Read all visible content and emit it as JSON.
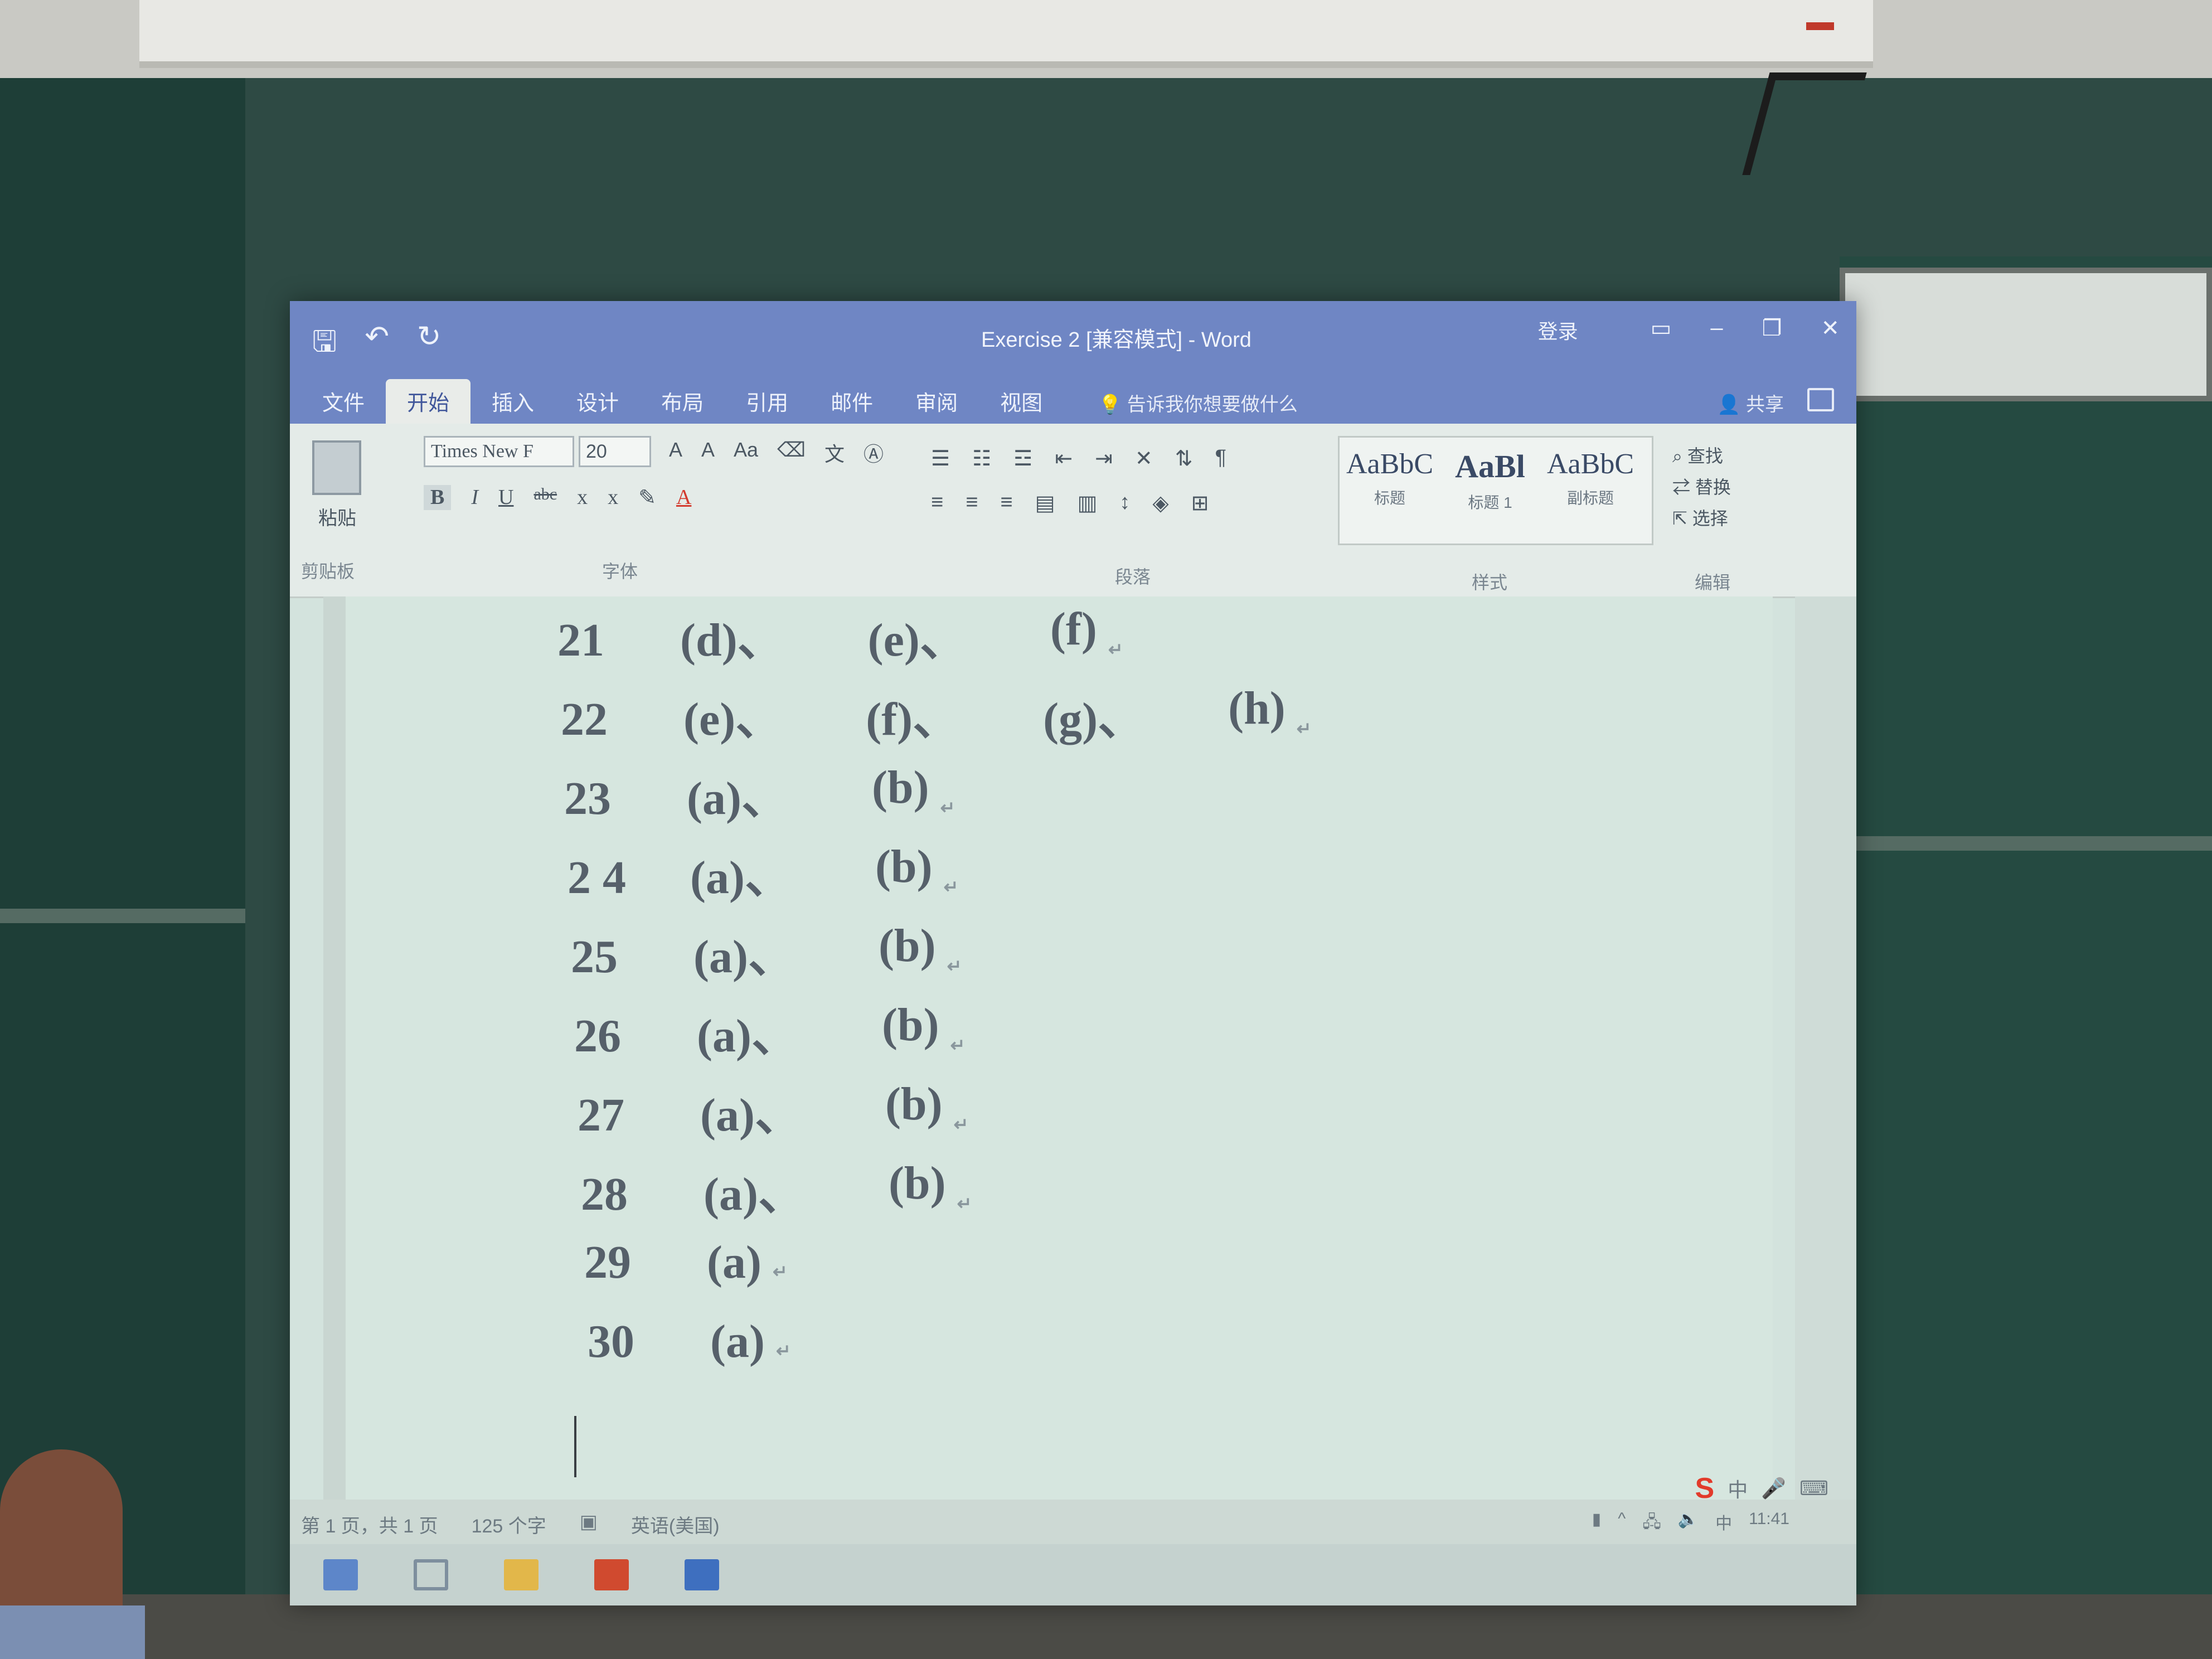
{
  "window": {
    "title": "Exercise 2 [兼容模式] - Word",
    "login": "登录",
    "share": "共享",
    "tell_me": "告诉我你想要做什么"
  },
  "quick_access": {
    "save_icon": "save-icon",
    "undo_icon": "undo-icon",
    "redo_icon": "redo-icon"
  },
  "tabs": [
    "文件",
    "开始",
    "插入",
    "设计",
    "布局",
    "引用",
    "邮件",
    "审阅",
    "视图"
  ],
  "active_tab": "开始",
  "ribbon": {
    "clipboard": {
      "paste_label": "粘贴",
      "group_label": "剪贴板"
    },
    "font": {
      "font_name": "Times New F",
      "font_size": "20",
      "group_label": "字体",
      "grow": "A",
      "shrink": "A",
      "case": "Aa",
      "bold": "B",
      "italic": "I",
      "underline": "U",
      "strike": "abc",
      "subscript": "x",
      "superscript": "x",
      "font_color": "A"
    },
    "paragraph": {
      "group_label": "段落"
    },
    "styles": {
      "group_label": "样式",
      "items": [
        {
          "sample": "AaBbC",
          "name": "标题"
        },
        {
          "sample": "AaBl",
          "name": "标题 1"
        },
        {
          "sample": "AaBbC",
          "name": "副标题"
        }
      ]
    },
    "editing": {
      "group_label": "编辑",
      "find": "查找",
      "replace": "替换",
      "select": "选择"
    }
  },
  "document": {
    "lines": [
      {
        "num": "21",
        "options": [
          "(d)、",
          "(e)、",
          "(f)"
        ]
      },
      {
        "num": "22",
        "options": [
          "(e)、",
          "(f)、",
          "(g)、",
          "(h)"
        ]
      },
      {
        "num": "23",
        "options": [
          "(a)、",
          "(b)"
        ]
      },
      {
        "num": "2 4",
        "options": [
          "(a)、",
          "(b)"
        ]
      },
      {
        "num": "25",
        "options": [
          "(a)、",
          "(b)"
        ]
      },
      {
        "num": "26",
        "options": [
          "(a)、",
          "(b)"
        ]
      },
      {
        "num": "27",
        "options": [
          "(a)、",
          "(b)"
        ]
      },
      {
        "num": "28",
        "options": [
          "(a)、",
          "(b)"
        ]
      },
      {
        "num": "29",
        "options": [
          "(a)"
        ]
      },
      {
        "num": "30",
        "options": [
          "(a)"
        ]
      }
    ],
    "paragraph_mark": "↵"
  },
  "status": {
    "page": "第 1 页，共 1 页",
    "words": "125 个字",
    "language": "英语(美国)"
  },
  "tray": {
    "ime": "中",
    "time": "11:41"
  },
  "colors": {
    "titlebar": "#6f86c4",
    "ribbon": "#e4ebe8",
    "page": "#d6e6df"
  }
}
